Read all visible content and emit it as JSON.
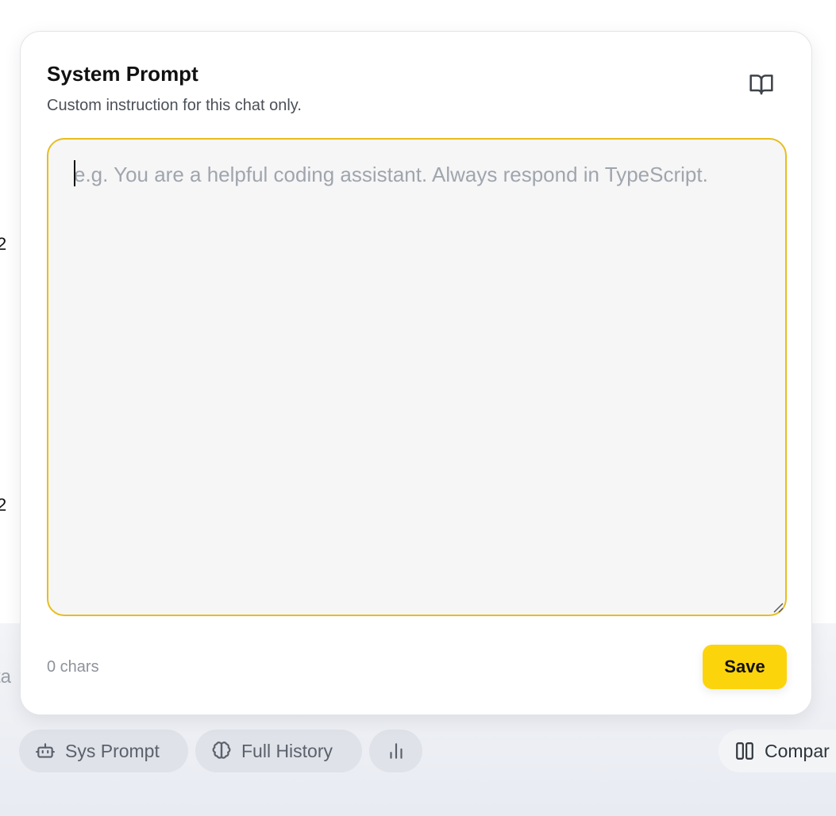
{
  "modal": {
    "title": "System Prompt",
    "subtitle": "Custom instruction for this chat only.",
    "icon": "book-open-icon",
    "textarea": {
      "value": "",
      "placeholder": "e.g. You are a helpful coding assistant. Always respond in TypeScript."
    },
    "char_count": "0 chars",
    "save_label": "Save"
  },
  "toolbar": {
    "sys_prompt_label": "Sys Prompt",
    "full_history_label": "Full History",
    "stats_icon": "bar-chart-icon",
    "compare_label": "Compar"
  },
  "background": {
    "fragment_1": "2",
    "fragment_2": "2",
    "fragment_3": "ta"
  },
  "colors": {
    "accent": "#fcd40c",
    "focus_border": "#e8bd1c",
    "chip_bg": "#dfe2e8"
  }
}
